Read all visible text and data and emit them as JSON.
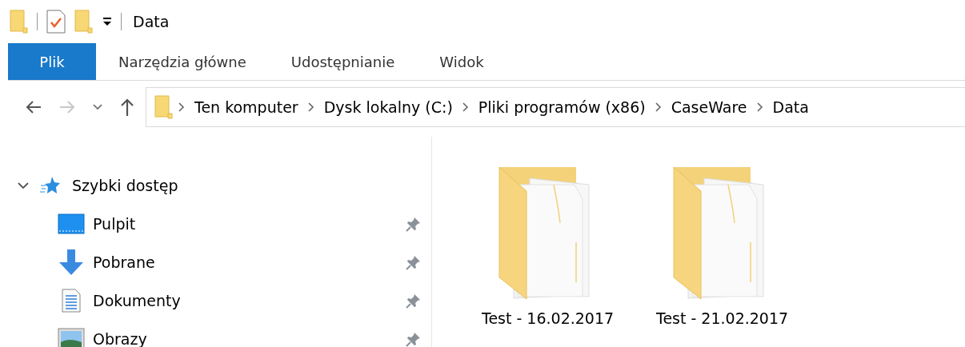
{
  "window": {
    "title": "Data"
  },
  "ribbon_tabs": [
    {
      "label": "Plik",
      "selected": true
    },
    {
      "label": "Narzędzia główne",
      "selected": false
    },
    {
      "label": "Udostępnianie",
      "selected": false
    },
    {
      "label": "Widok",
      "selected": false
    }
  ],
  "navigation": {
    "back": {
      "disabled": false
    },
    "forward": {
      "disabled": true
    }
  },
  "breadcrumb": [
    "Ten komputer",
    "Dysk lokalny (C:)",
    "Pliki programów (x86)",
    "CaseWare",
    "Data"
  ],
  "quick_access": {
    "label": "Szybki dostęp",
    "expanded": true,
    "children": [
      {
        "label": "Pulpit",
        "kind": "desktop",
        "pinned": true
      },
      {
        "label": "Pobrane",
        "kind": "downloads",
        "pinned": true
      },
      {
        "label": "Dokumenty",
        "kind": "documents",
        "pinned": true
      },
      {
        "label": "Obrazy",
        "kind": "pictures",
        "pinned": true
      }
    ]
  },
  "items": [
    {
      "name": "Test - 16.02.2017"
    },
    {
      "name": "Test - 21.02.2017"
    }
  ]
}
